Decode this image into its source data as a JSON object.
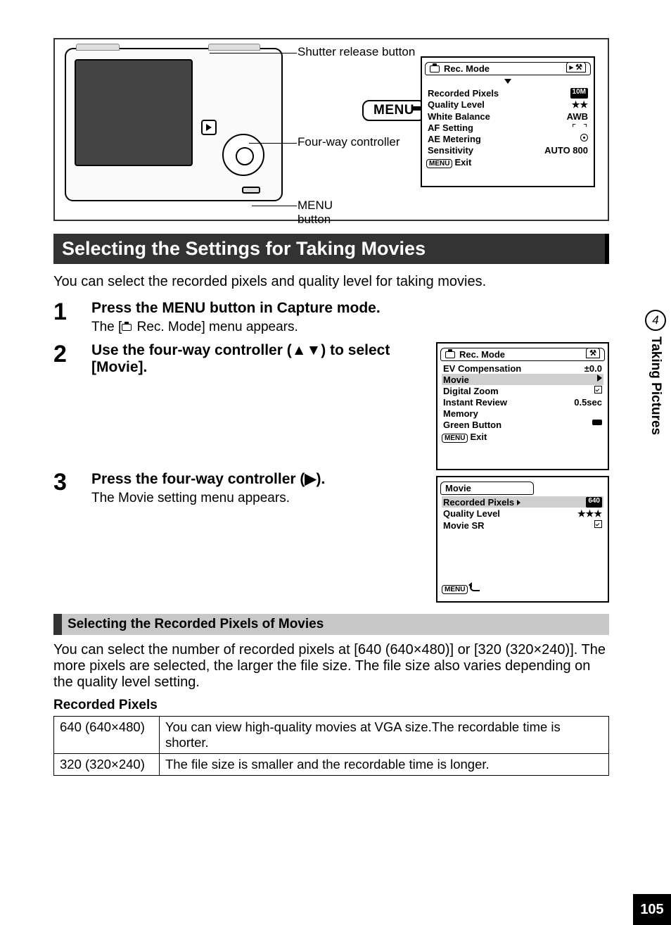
{
  "diagram": {
    "labels": {
      "shutter": "Shutter release button",
      "fourway": "Four-way controller",
      "menu_button": "MENU button"
    },
    "menu_box": "MENU"
  },
  "lcd1": {
    "title": "Rec. Mode",
    "rows": [
      {
        "k": "Recorded Pixels",
        "v": "10M",
        "pill": true
      },
      {
        "k": "Quality Level",
        "v": "★★"
      },
      {
        "k": "White Balance",
        "v": "AWB"
      },
      {
        "k": "AF Setting",
        "v": "[  ]",
        "bracket": true
      },
      {
        "k": "AE Metering",
        "v": "⊙",
        "target": true
      },
      {
        "k": "Sensitivity",
        "v": "AUTO 800"
      }
    ],
    "exit": "Exit",
    "menu_sm": "MENU"
  },
  "heading": "Selecting the Settings for Taking Movies",
  "intro": "You can select the recorded pixels and quality level for taking movies.",
  "steps": [
    {
      "num": "1",
      "title": "Press the MENU button in Capture mode.",
      "desc_pre": "The [",
      "desc_post": " Rec. Mode] menu appears."
    },
    {
      "num": "2",
      "title": "Use the four-way controller (▲▼) to select [Movie].",
      "desc": ""
    },
    {
      "num": "3",
      "title": "Press the four-way controller (▶).",
      "desc": "The Movie setting menu appears."
    }
  ],
  "lcd2": {
    "title": "Rec. Mode",
    "rows": [
      {
        "k": "EV Compensation",
        "v": "±0.0"
      },
      {
        "k": "Movie",
        "v": "▶",
        "hi": true
      },
      {
        "k": "Digital Zoom",
        "v": "check"
      },
      {
        "k": "Instant Review",
        "v": "0.5sec"
      },
      {
        "k": "Memory",
        "v": ""
      },
      {
        "k": "Green Button",
        "v": "▬"
      }
    ],
    "exit": "Exit",
    "menu_sm": "MENU"
  },
  "lcd3": {
    "title": "Movie",
    "rows": [
      {
        "k": "Recorded Pixels",
        "v": "640",
        "hi": true,
        "pill": true,
        "arrow": true
      },
      {
        "k": "Quality Level",
        "v": "★★★"
      },
      {
        "k": "Movie SR",
        "v": "check"
      }
    ],
    "menu_sm": "MENU"
  },
  "sub_heading": "Selecting the Recorded Pixels of Movies",
  "sub_para": "You can select the number of recorded pixels at [640 (640×480)] or [320 (320×240)]. The more pixels are selected, the larger the file size. The file size also varies depending on the quality level setting.",
  "table_title": "Recorded Pixels",
  "table": [
    {
      "k": "640 (640×480)",
      "v": "You can view high-quality movies at VGA size.The recordable time is shorter."
    },
    {
      "k": "320 (320×240)",
      "v": "The file size is smaller and the recordable time is longer."
    }
  ],
  "side": {
    "num": "4",
    "text": "Taking Pictures"
  },
  "page_num": "105"
}
